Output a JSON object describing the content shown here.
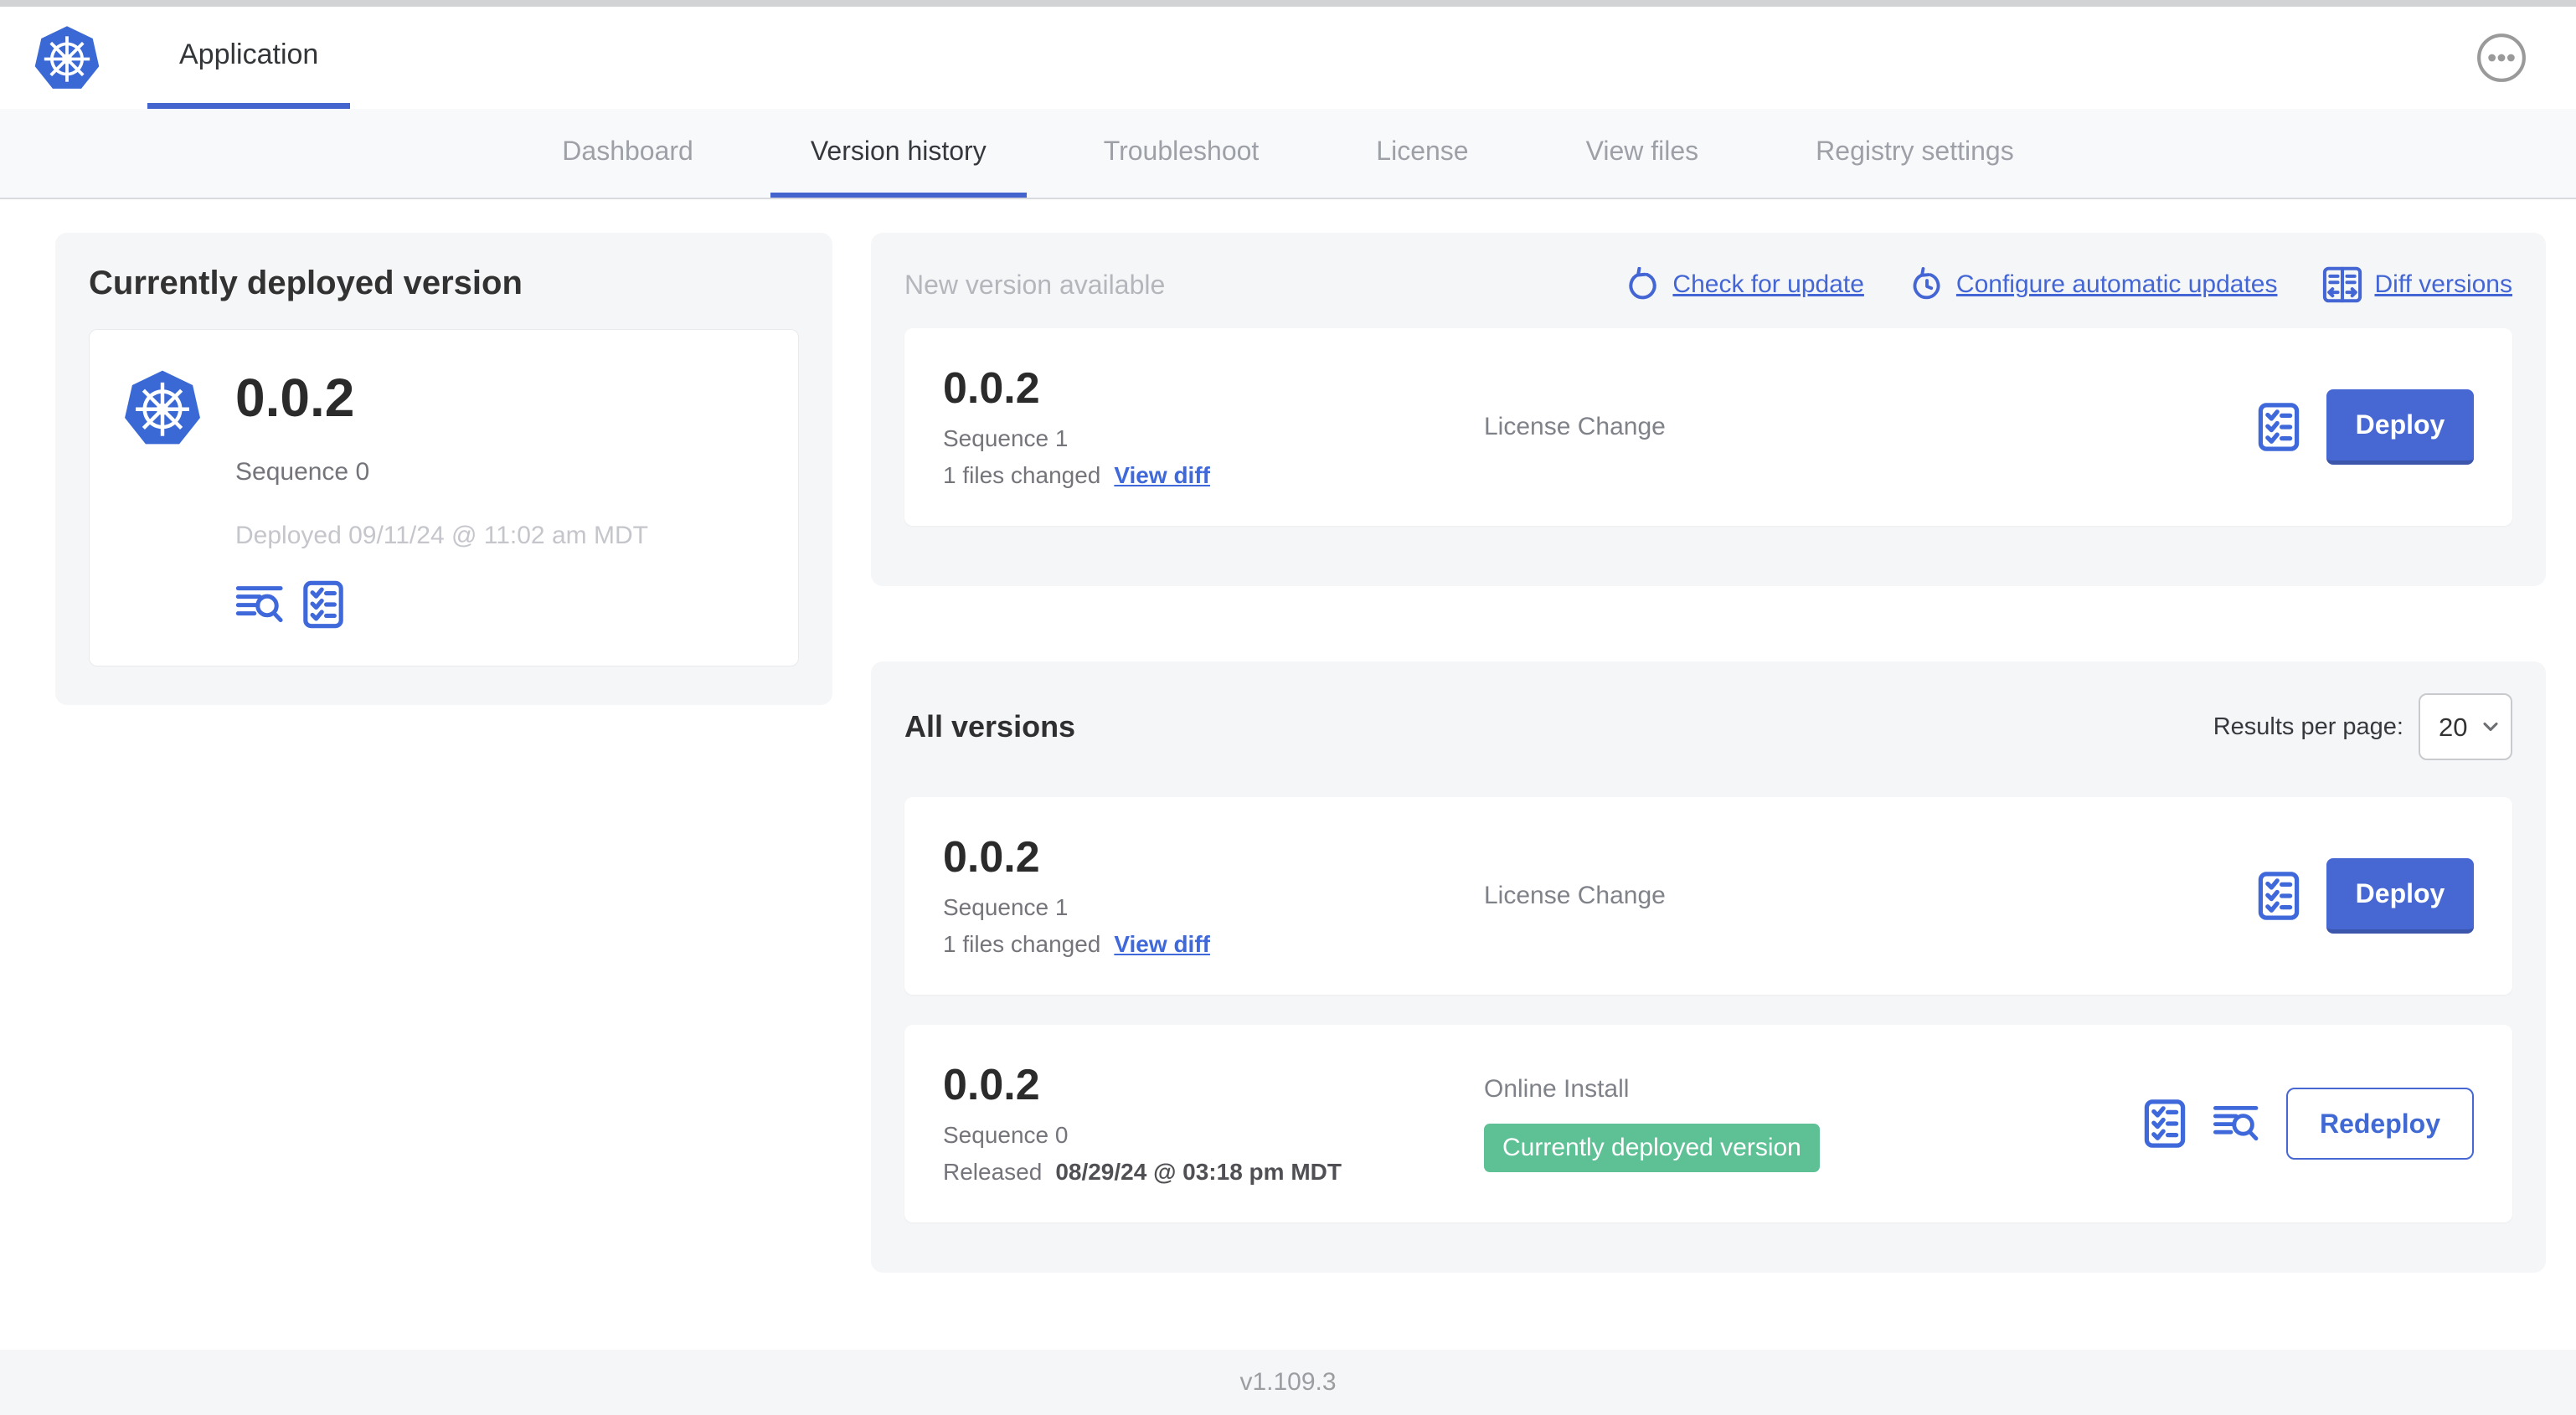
{
  "header": {
    "app_tab_label": "Application"
  },
  "nav": {
    "tabs": [
      "Dashboard",
      "Version history",
      "Troubleshoot",
      "License",
      "View files",
      "Registry settings"
    ],
    "active_tab": "Version history"
  },
  "deployed_card": {
    "title": "Currently deployed version",
    "version": "0.0.2",
    "sequence": "Sequence 0",
    "deployed_at": "Deployed 09/11/24 @ 11:02 am MDT"
  },
  "new_version": {
    "title": "New version available",
    "actions": {
      "check_for_update": "Check for update",
      "configure_automatic_updates": "Configure automatic updates",
      "diff_versions": "Diff versions"
    },
    "row": {
      "version": "0.0.2",
      "sequence": "Sequence 1",
      "files_changed": "1 files changed",
      "view_diff": "View diff",
      "source": "License Change",
      "action_label": "Deploy"
    }
  },
  "all_versions": {
    "title": "All versions",
    "results_per_page_label": "Results per page:",
    "results_per_page_value": "20",
    "rows": [
      {
        "version": "0.0.2",
        "sequence": "Sequence 1",
        "files_changed": "1 files changed",
        "view_diff": "View diff",
        "source": "License Change",
        "action_label": "Deploy"
      },
      {
        "version": "0.0.2",
        "sequence": "Sequence 0",
        "released_prefix": "Released",
        "released_date": "08/29/24 @ 03:18 pm MDT",
        "source": "Online Install",
        "badge": "Currently deployed version",
        "action_label": "Redeploy"
      }
    ]
  },
  "footer": {
    "app_version": "v1.109.3"
  },
  "colors": {
    "link_blue": "#4466d4",
    "button_blue": "#4767d2",
    "button_blue_shadow": "#3c56ab",
    "badge_green": "#5ec195",
    "panel_gray": "#f5f6f8",
    "kubernetes_logo_blue": "#3a69d6"
  },
  "icons": {
    "brand": "kubernetes-logo",
    "header_menu": "ellipsis-icon",
    "check_for_update": "refresh-icon",
    "configure_automatic_updates": "clock-refresh-icon",
    "diff_versions": "diff-columns-icon",
    "preflight": "checklist-icon",
    "logs": "log-search-icon",
    "select": "chevron-down-icon"
  }
}
